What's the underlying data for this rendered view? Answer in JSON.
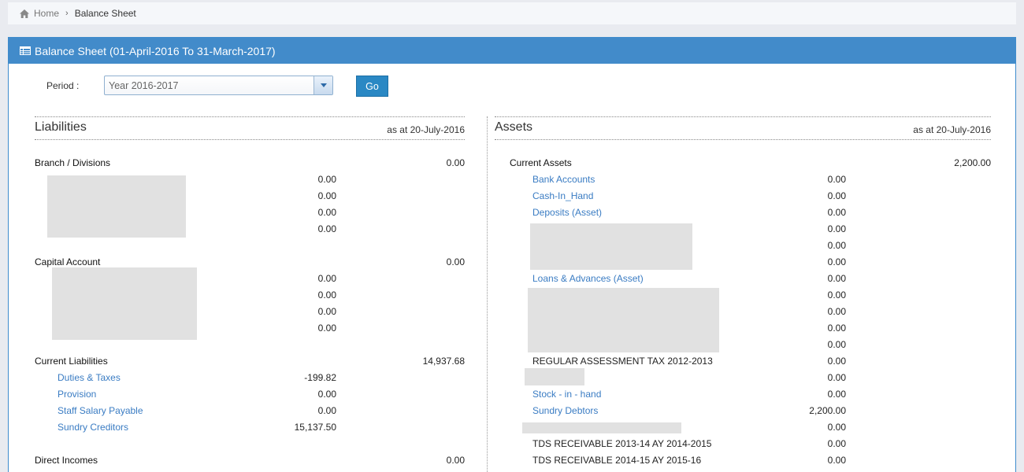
{
  "breadcrumb": {
    "home": "Home",
    "current": "Balance Sheet"
  },
  "panel": {
    "title": "Balance Sheet (01-April-2016 To 31-March-2017)"
  },
  "period": {
    "label": "Period :",
    "selected": "Year 2016-2017",
    "go_label": "Go"
  },
  "liabilities": {
    "title": "Liabilities",
    "as_at": "as at 20-July-2016",
    "branch": {
      "name": "Branch / Divisions",
      "total": "0.00",
      "items": [
        "0.00",
        "0.00",
        "0.00",
        "0.00"
      ]
    },
    "capital": {
      "name": "Capital Account",
      "total": "0.00",
      "items": [
        "0.00",
        "0.00",
        "0.00",
        "0.00"
      ]
    },
    "current": {
      "name": "Current Liabilities",
      "total": "14,937.68",
      "items": [
        {
          "name": "Duties & Taxes",
          "value": "-199.82"
        },
        {
          "name": "Provision",
          "value": "0.00"
        },
        {
          "name": "Staff Salary Payable",
          "value": "0.00"
        },
        {
          "name": "Sundry Creditors",
          "value": "15,137.50"
        }
      ]
    },
    "direct_incomes": {
      "name": "Direct Incomes",
      "total": "0.00"
    }
  },
  "assets": {
    "title": "Assets",
    "as_at": "as at 20-July-2016",
    "current_assets": {
      "name": "Current Assets",
      "total": "2,200.00",
      "bank_accounts": {
        "name": "Bank Accounts",
        "value": "0.00"
      },
      "cash_in_hand": {
        "name": "Cash-In_Hand",
        "value": "0.00"
      },
      "deposits": {
        "name": "Deposits (Asset)",
        "value": "0.00"
      },
      "deposits_hidden": [
        "0.00",
        "0.00",
        "0.00"
      ],
      "loans": {
        "name": "Loans & Advances (Asset)",
        "value": "0.00"
      },
      "loans_hidden": [
        "0.00",
        "0.00",
        "0.00",
        "0.00"
      ],
      "regular_tax": {
        "name": "REGULAR ASSESSMENT TAX 2012-2013",
        "value": "0.00"
      },
      "hidden_after_tax": "0.00",
      "stock": {
        "name": "Stock - in - hand",
        "value": "0.00"
      },
      "sundry_debtors": {
        "name": "Sundry Debtors",
        "value": "2,200.00"
      },
      "hidden_after_debtors": "0.00",
      "tds_1": {
        "name": "TDS RECEIVABLE 2013-14 AY 2014-2015",
        "value": "0.00"
      },
      "tds_2": {
        "name": "TDS RECEIVABLE 2014-15 AY 2015-16",
        "value": "0.00"
      }
    }
  }
}
